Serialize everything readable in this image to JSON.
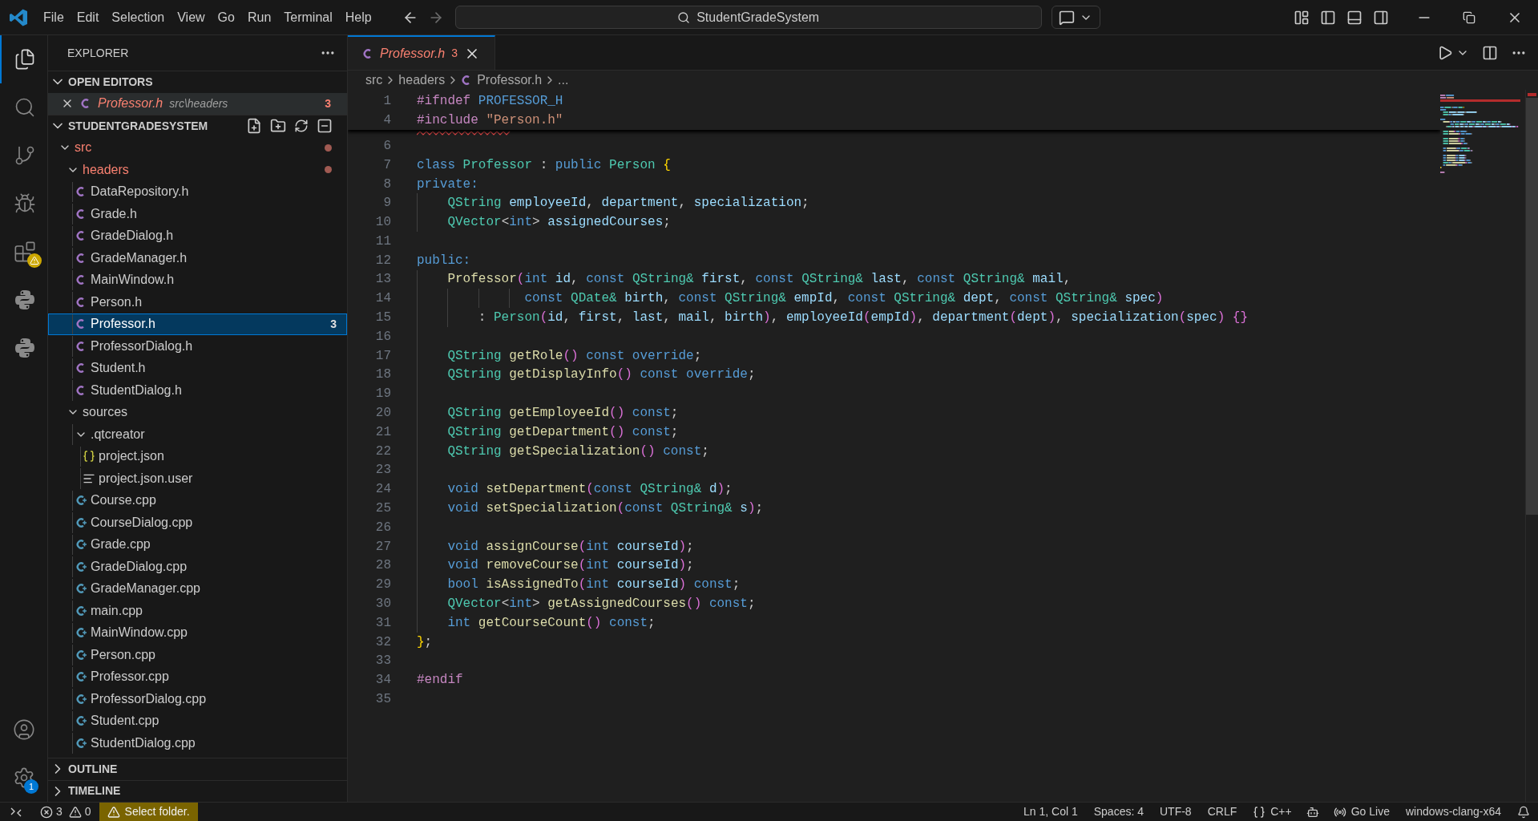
{
  "title_bar": {
    "menus": [
      "File",
      "Edit",
      "Selection",
      "View",
      "Go",
      "Run",
      "Terminal",
      "Help"
    ],
    "search": "StudentGradeSystem"
  },
  "activity_bar": {
    "items": [
      {
        "kind": "explorer",
        "selected": true,
        "warning": false
      },
      {
        "kind": "search",
        "selected": false,
        "warning": false
      },
      {
        "kind": "scm",
        "selected": false,
        "warning": false
      },
      {
        "kind": "debug",
        "selected": false,
        "warning": false
      },
      {
        "kind": "extensions",
        "selected": false,
        "warning": true
      },
      {
        "kind": "python",
        "selected": false,
        "warning": false
      },
      {
        "kind": "python",
        "selected": false,
        "warning": false
      }
    ],
    "bottom_items": [
      {
        "kind": "account"
      },
      {
        "kind": "settings",
        "badge": "1"
      }
    ]
  },
  "sidebar": {
    "title": "EXPLORER",
    "open_editors": {
      "title": "OPEN EDITORS",
      "expanded": true,
      "items": [
        {
          "name": "Professor.h",
          "path": "src\\headers",
          "badge": "3",
          "error": true,
          "preview": true
        }
      ]
    },
    "project": {
      "title": "STUDENTGRADESYSTEM",
      "expanded": true,
      "tree": [
        {
          "label": "src",
          "kind": "folder",
          "expanded": true,
          "error": true,
          "selected": false,
          "children": [
            {
              "label": "headers",
              "kind": "folder",
              "expanded": true,
              "error": true,
              "selected": false,
              "children": [
                {
                  "label": "DataRepository.h",
                  "kind": "c",
                  "error": false,
                  "selected": false
                },
                {
                  "label": "Grade.h",
                  "kind": "c",
                  "error": false,
                  "selected": false
                },
                {
                  "label": "GradeDialog.h",
                  "kind": "c",
                  "error": false,
                  "selected": false
                },
                {
                  "label": "GradeManager.h",
                  "kind": "c",
                  "error": false,
                  "selected": false
                },
                {
                  "label": "MainWindow.h",
                  "kind": "c",
                  "error": false,
                  "selected": false
                },
                {
                  "label": "Person.h",
                  "kind": "c",
                  "error": false,
                  "selected": false
                },
                {
                  "label": "Professor.h",
                  "kind": "c",
                  "error": true,
                  "selected": true,
                  "badge": "3"
                },
                {
                  "label": "ProfessorDialog.h",
                  "kind": "c",
                  "error": false,
                  "selected": false
                },
                {
                  "label": "Student.h",
                  "kind": "c",
                  "error": false,
                  "selected": false
                },
                {
                  "label": "StudentDialog.h",
                  "kind": "c",
                  "error": false,
                  "selected": false
                }
              ]
            },
            {
              "label": "sources",
              "kind": "folder",
              "expanded": true,
              "error": false,
              "selected": false,
              "children": [
                {
                  "label": ".qtcreator",
                  "kind": "folder",
                  "expanded": true,
                  "error": false,
                  "selected": false,
                  "children": [
                    {
                      "label": "project.json",
                      "kind": "json",
                      "error": false,
                      "selected": false
                    },
                    {
                      "label": "project.json.user",
                      "kind": "text",
                      "error": false,
                      "selected": false
                    }
                  ]
                },
                {
                  "label": "Course.cpp",
                  "kind": "cpp",
                  "error": false,
                  "selected": false
                },
                {
                  "label": "CourseDialog.cpp",
                  "kind": "cpp",
                  "error": false,
                  "selected": false
                },
                {
                  "label": "Grade.cpp",
                  "kind": "cpp",
                  "error": false,
                  "selected": false
                },
                {
                  "label": "GradeDialog.cpp",
                  "kind": "cpp",
                  "error": false,
                  "selected": false
                },
                {
                  "label": "GradeManager.cpp",
                  "kind": "cpp",
                  "error": false,
                  "selected": false
                },
                {
                  "label": "main.cpp",
                  "kind": "cpp",
                  "error": false,
                  "selected": false
                },
                {
                  "label": "MainWindow.cpp",
                  "kind": "cpp",
                  "error": false,
                  "selected": false
                },
                {
                  "label": "Person.cpp",
                  "kind": "cpp",
                  "error": false,
                  "selected": false
                },
                {
                  "label": "Professor.cpp",
                  "kind": "cpp",
                  "error": false,
                  "selected": false
                },
                {
                  "label": "ProfessorDialog.cpp",
                  "kind": "cpp",
                  "error": false,
                  "selected": false
                },
                {
                  "label": "Student.cpp",
                  "kind": "cpp",
                  "error": false,
                  "selected": false
                },
                {
                  "label": "StudentDialog.cpp",
                  "kind": "cpp",
                  "error": false,
                  "selected": false
                }
              ]
            }
          ]
        }
      ]
    },
    "outline": {
      "title": "OUTLINE",
      "expanded": false
    },
    "timeline": {
      "title": "TIMELINE",
      "expanded": false
    }
  },
  "editor": {
    "tabs": [
      {
        "name": "Professor.h",
        "badge": "3",
        "error": true,
        "preview": true,
        "selected": true
      }
    ],
    "breadcrumb": [
      {
        "kind": "folder",
        "text": "src"
      },
      {
        "kind": "folder",
        "text": "headers"
      },
      {
        "kind": "file",
        "text": "Professor.h"
      },
      {
        "kind": "more",
        "text": "..."
      }
    ],
    "squiggle": true,
    "sticky": [
      {
        "number": "1",
        "tokens": [
          {
            "kind": "macro",
            "text": "#ifndef"
          },
          {
            "kind": "macroname",
            "text": " PROFESSOR_H"
          }
        ]
      },
      {
        "number": "4",
        "tokens": [
          {
            "kind": "macro",
            "text": "#include"
          },
          {
            "kind": "str",
            "text": " \"Person.h\""
          }
        ]
      }
    ],
    "lines": [
      {
        "number": "6"
      },
      {
        "number": "7",
        "tokens": [
          {
            "kind": "kw",
            "text": "class"
          },
          {
            "kind": "type",
            "text": " Professor"
          },
          {
            "kind": "plain",
            "text": " : "
          },
          {
            "kind": "kw",
            "text": "public"
          },
          {
            "kind": "type",
            "text": " Person"
          },
          {
            "kind": "b1",
            "text": " {"
          }
        ]
      },
      {
        "number": "8",
        "tokens": [
          {
            "kind": "kw",
            "text": "private:"
          }
        ]
      },
      {
        "number": "9",
        "tokens": [
          {
            "kind": "type",
            "text": "    QString"
          },
          {
            "kind": "var",
            "text": " employeeId"
          },
          {
            "kind": "plain",
            "text": ", "
          },
          {
            "kind": "var",
            "text": "department"
          },
          {
            "kind": "plain",
            "text": ", "
          },
          {
            "kind": "var",
            "text": "specialization"
          },
          {
            "kind": "plain",
            "text": ";"
          }
        ]
      },
      {
        "number": "10",
        "tokens": [
          {
            "kind": "type",
            "text": "    QVector"
          },
          {
            "kind": "plain",
            "text": "<"
          },
          {
            "kind": "kw",
            "text": "int"
          },
          {
            "kind": "plain",
            "text": "> "
          },
          {
            "kind": "var",
            "text": "assignedCourses"
          },
          {
            "kind": "plain",
            "text": ";"
          }
        ]
      },
      {
        "number": "11"
      },
      {
        "number": "12",
        "tokens": [
          {
            "kind": "kw",
            "text": "public:"
          }
        ]
      },
      {
        "number": "13",
        "tokens": [
          {
            "kind": "fn",
            "text": "    Professor"
          },
          {
            "kind": "b2",
            "text": "("
          },
          {
            "kind": "kw",
            "text": "int"
          },
          {
            "kind": "var",
            "text": " id"
          },
          {
            "kind": "plain",
            "text": ", "
          },
          {
            "kind": "kw",
            "text": "const"
          },
          {
            "kind": "type",
            "text": " QString&"
          },
          {
            "kind": "var",
            "text": " first"
          },
          {
            "kind": "plain",
            "text": ", "
          },
          {
            "kind": "kw",
            "text": "const"
          },
          {
            "kind": "type",
            "text": " QString&"
          },
          {
            "kind": "var",
            "text": " last"
          },
          {
            "kind": "plain",
            "text": ", "
          },
          {
            "kind": "kw",
            "text": "const"
          },
          {
            "kind": "type",
            "text": " QString&"
          },
          {
            "kind": "var",
            "text": " mail"
          },
          {
            "kind": "plain",
            "text": ","
          }
        ]
      },
      {
        "number": "14",
        "tokens": [
          {
            "kind": "kw",
            "text": "              const"
          },
          {
            "kind": "type",
            "text": " QDate&"
          },
          {
            "kind": "var",
            "text": " birth"
          },
          {
            "kind": "plain",
            "text": ", "
          },
          {
            "kind": "kw",
            "text": "const"
          },
          {
            "kind": "type",
            "text": " QString&"
          },
          {
            "kind": "var",
            "text": " empId"
          },
          {
            "kind": "plain",
            "text": ", "
          },
          {
            "kind": "kw",
            "text": "const"
          },
          {
            "kind": "type",
            "text": " QString&"
          },
          {
            "kind": "var",
            "text": " dept"
          },
          {
            "kind": "plain",
            "text": ", "
          },
          {
            "kind": "kw",
            "text": "const"
          },
          {
            "kind": "type",
            "text": " QString&"
          },
          {
            "kind": "var",
            "text": " spec"
          },
          {
            "kind": "b2",
            "text": ")"
          }
        ]
      },
      {
        "number": "15",
        "tokens": [
          {
            "kind": "plain",
            "text": "        : "
          },
          {
            "kind": "type",
            "text": "Person"
          },
          {
            "kind": "b2",
            "text": "("
          },
          {
            "kind": "var",
            "text": "id"
          },
          {
            "kind": "plain",
            "text": ", "
          },
          {
            "kind": "var",
            "text": "first"
          },
          {
            "kind": "plain",
            "text": ", "
          },
          {
            "kind": "var",
            "text": "last"
          },
          {
            "kind": "plain",
            "text": ", "
          },
          {
            "kind": "var",
            "text": "mail"
          },
          {
            "kind": "plain",
            "text": ", "
          },
          {
            "kind": "var",
            "text": "birth"
          },
          {
            "kind": "b2",
            "text": ")"
          },
          {
            "kind": "plain",
            "text": ", "
          },
          {
            "kind": "var",
            "text": "employeeId"
          },
          {
            "kind": "b2",
            "text": "("
          },
          {
            "kind": "var",
            "text": "empId"
          },
          {
            "kind": "b2",
            "text": ")"
          },
          {
            "kind": "plain",
            "text": ", "
          },
          {
            "kind": "var",
            "text": "department"
          },
          {
            "kind": "b2",
            "text": "("
          },
          {
            "kind": "var",
            "text": "dept"
          },
          {
            "kind": "b2",
            "text": ")"
          },
          {
            "kind": "plain",
            "text": ", "
          },
          {
            "kind": "var",
            "text": "specialization"
          },
          {
            "kind": "b2",
            "text": "("
          },
          {
            "kind": "var",
            "text": "spec"
          },
          {
            "kind": "b2",
            "text": ")"
          },
          {
            "kind": "b2",
            "text": " {}"
          }
        ]
      },
      {
        "number": "16"
      },
      {
        "number": "17",
        "tokens": [
          {
            "kind": "type",
            "text": "    QString"
          },
          {
            "kind": "fn",
            "text": " getRole"
          },
          {
            "kind": "b2",
            "text": "()"
          },
          {
            "kind": "kw",
            "text": " const"
          },
          {
            "kind": "kw",
            "text": " override"
          },
          {
            "kind": "plain",
            "text": ";"
          }
        ]
      },
      {
        "number": "18",
        "tokens": [
          {
            "kind": "type",
            "text": "    QString"
          },
          {
            "kind": "fn",
            "text": " getDisplayInfo"
          },
          {
            "kind": "b2",
            "text": "()"
          },
          {
            "kind": "kw",
            "text": " const"
          },
          {
            "kind": "kw",
            "text": " override"
          },
          {
            "kind": "plain",
            "text": ";"
          }
        ]
      },
      {
        "number": "19"
      },
      {
        "number": "20",
        "tokens": [
          {
            "kind": "type",
            "text": "    QString"
          },
          {
            "kind": "fn",
            "text": " getEmployeeId"
          },
          {
            "kind": "b2",
            "text": "()"
          },
          {
            "kind": "kw",
            "text": " const"
          },
          {
            "kind": "plain",
            "text": ";"
          }
        ]
      },
      {
        "number": "21",
        "tokens": [
          {
            "kind": "type",
            "text": "    QString"
          },
          {
            "kind": "fn",
            "text": " getDepartment"
          },
          {
            "kind": "b2",
            "text": "()"
          },
          {
            "kind": "kw",
            "text": " const"
          },
          {
            "kind": "plain",
            "text": ";"
          }
        ]
      },
      {
        "number": "22",
        "tokens": [
          {
            "kind": "type",
            "text": "    QString"
          },
          {
            "kind": "fn",
            "text": " getSpecialization"
          },
          {
            "kind": "b2",
            "text": "()"
          },
          {
            "kind": "kw",
            "text": " const"
          },
          {
            "kind": "plain",
            "text": ";"
          }
        ]
      },
      {
        "number": "23"
      },
      {
        "number": "24",
        "tokens": [
          {
            "kind": "kw",
            "text": "    void"
          },
          {
            "kind": "fn",
            "text": " setDepartment"
          },
          {
            "kind": "b2",
            "text": "("
          },
          {
            "kind": "kw",
            "text": "const"
          },
          {
            "kind": "type",
            "text": " QString&"
          },
          {
            "kind": "var",
            "text": " d"
          },
          {
            "kind": "b2",
            "text": ")"
          },
          {
            "kind": "plain",
            "text": ";"
          }
        ]
      },
      {
        "number": "25",
        "tokens": [
          {
            "kind": "kw",
            "text": "    void"
          },
          {
            "kind": "fn",
            "text": " setSpecialization"
          },
          {
            "kind": "b2",
            "text": "("
          },
          {
            "kind": "kw",
            "text": "const"
          },
          {
            "kind": "type",
            "text": " QString&"
          },
          {
            "kind": "var",
            "text": " s"
          },
          {
            "kind": "b2",
            "text": ")"
          },
          {
            "kind": "plain",
            "text": ";"
          }
        ]
      },
      {
        "number": "26"
      },
      {
        "number": "27",
        "tokens": [
          {
            "kind": "kw",
            "text": "    void"
          },
          {
            "kind": "fn",
            "text": " assignCourse"
          },
          {
            "kind": "b2",
            "text": "("
          },
          {
            "kind": "kw",
            "text": "int"
          },
          {
            "kind": "var",
            "text": " courseId"
          },
          {
            "kind": "b2",
            "text": ")"
          },
          {
            "kind": "plain",
            "text": ";"
          }
        ]
      },
      {
        "number": "28",
        "tokens": [
          {
            "kind": "kw",
            "text": "    void"
          },
          {
            "kind": "fn",
            "text": " removeCourse"
          },
          {
            "kind": "b2",
            "text": "("
          },
          {
            "kind": "kw",
            "text": "int"
          },
          {
            "kind": "var",
            "text": " courseId"
          },
          {
            "kind": "b2",
            "text": ")"
          },
          {
            "kind": "plain",
            "text": ";"
          }
        ]
      },
      {
        "number": "29",
        "tokens": [
          {
            "kind": "kw",
            "text": "    bool"
          },
          {
            "kind": "fn",
            "text": " isAssignedTo"
          },
          {
            "kind": "b2",
            "text": "("
          },
          {
            "kind": "kw",
            "text": "int"
          },
          {
            "kind": "var",
            "text": " courseId"
          },
          {
            "kind": "b2",
            "text": ")"
          },
          {
            "kind": "kw",
            "text": " const"
          },
          {
            "kind": "plain",
            "text": ";"
          }
        ]
      },
      {
        "number": "30",
        "tokens": [
          {
            "kind": "type",
            "text": "    QVector"
          },
          {
            "kind": "plain",
            "text": "<"
          },
          {
            "kind": "kw",
            "text": "int"
          },
          {
            "kind": "plain",
            "text": "> "
          },
          {
            "kind": "fn",
            "text": "getAssignedCourses"
          },
          {
            "kind": "b2",
            "text": "()"
          },
          {
            "kind": "kw",
            "text": " const"
          },
          {
            "kind": "plain",
            "text": ";"
          }
        ]
      },
      {
        "number": "31",
        "tokens": [
          {
            "kind": "kw",
            "text": "    int"
          },
          {
            "kind": "fn",
            "text": " getCourseCount"
          },
          {
            "kind": "b2",
            "text": "()"
          },
          {
            "kind": "kw",
            "text": " const"
          },
          {
            "kind": "plain",
            "text": ";"
          }
        ]
      },
      {
        "number": "32",
        "tokens": [
          {
            "kind": "b1",
            "text": "}"
          },
          {
            "kind": "plain",
            "text": ";"
          }
        ]
      },
      {
        "number": "33"
      },
      {
        "number": "34",
        "tokens": [
          {
            "kind": "macro",
            "text": "#endif"
          }
        ]
      },
      {
        "number": "35"
      }
    ]
  },
  "status_bar": {
    "errors": "3",
    "warnings": "0",
    "notice": "Select folder.",
    "right": [
      {
        "kind": "text",
        "text": "Ln 1, Col 1"
      },
      {
        "kind": "text",
        "text": "Spaces: 4"
      },
      {
        "kind": "text",
        "text": "UTF-8"
      },
      {
        "kind": "text",
        "text": "CRLF"
      },
      {
        "kind": "language",
        "text": "C++"
      },
      {
        "kind": "copilot"
      },
      {
        "kind": "live",
        "text": "Go Live"
      },
      {
        "kind": "text",
        "text": "windows-clang-x64"
      },
      {
        "kind": "bell"
      }
    ]
  }
}
